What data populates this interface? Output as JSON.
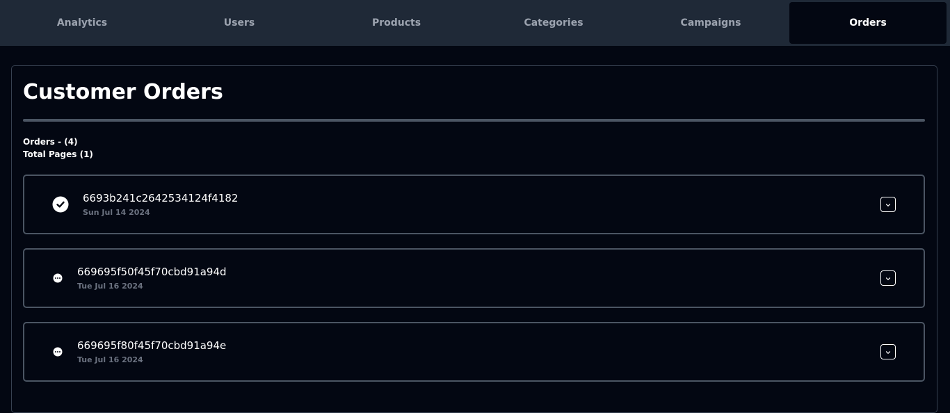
{
  "tabs": [
    {
      "label": "Analytics"
    },
    {
      "label": "Users"
    },
    {
      "label": "Products"
    },
    {
      "label": "Categories"
    },
    {
      "label": "Campaigns"
    },
    {
      "label": "Orders",
      "active": true
    }
  ],
  "page": {
    "title": "Customer Orders",
    "orders_count": "Orders - (4)",
    "total_pages": "Total Pages (1)"
  },
  "orders": [
    {
      "id": "6693b241c2642534124f4182",
      "date": "Sun Jul 14 2024",
      "status_icon": "check-circle-icon"
    },
    {
      "id": "669695f50f45f70cbd91a94d",
      "date": "Tue Jul 16 2024",
      "status_icon": "ellipsis-circle-icon"
    },
    {
      "id": "669695f80f45f70cbd91a94e",
      "date": "Tue Jul 16 2024",
      "status_icon": "ellipsis-circle-icon"
    }
  ],
  "colors": {
    "background": "#030712",
    "tabbar": "#1f2937",
    "border": "#4b5563",
    "muted_text": "#6b7280"
  }
}
